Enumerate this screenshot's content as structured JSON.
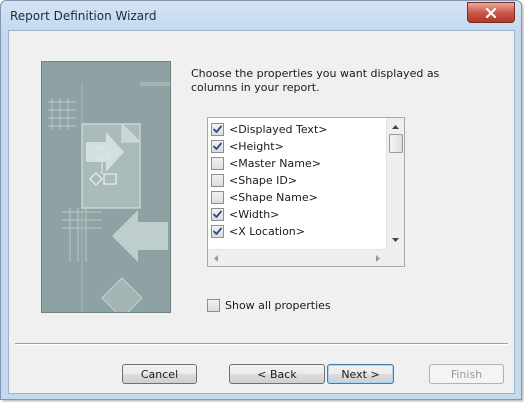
{
  "window": {
    "title": "Report Definition Wizard"
  },
  "icons": {
    "close": "close-icon",
    "scroll_up": "scroll-up-arrow-icon",
    "scroll_down": "scroll-down-arrow-icon",
    "scroll_left": "scroll-left-arrow-icon",
    "scroll_right": "scroll-right-arrow-icon",
    "checkmark": "checkmark-icon"
  },
  "colors": {
    "close_button": "#c85244",
    "titlebar": "#d5e4f3",
    "default_button_border": "#3c7fb1"
  },
  "instruction": "Choose the properties you want displayed as columns in your report.",
  "properties": [
    {
      "label": "<Displayed Text>",
      "checked": true
    },
    {
      "label": "<Height>",
      "checked": true
    },
    {
      "label": "<Master Name>",
      "checked": false
    },
    {
      "label": "<Shape ID>",
      "checked": false
    },
    {
      "label": "<Shape Name>",
      "checked": false
    },
    {
      "label": "<Width>",
      "checked": true
    },
    {
      "label": "<X Location>",
      "checked": true
    }
  ],
  "show_all": {
    "label": "Show all properties",
    "checked": false
  },
  "buttons": {
    "cancel": "Cancel",
    "back": "< Back",
    "next": "Next >",
    "finish": "Finish"
  }
}
